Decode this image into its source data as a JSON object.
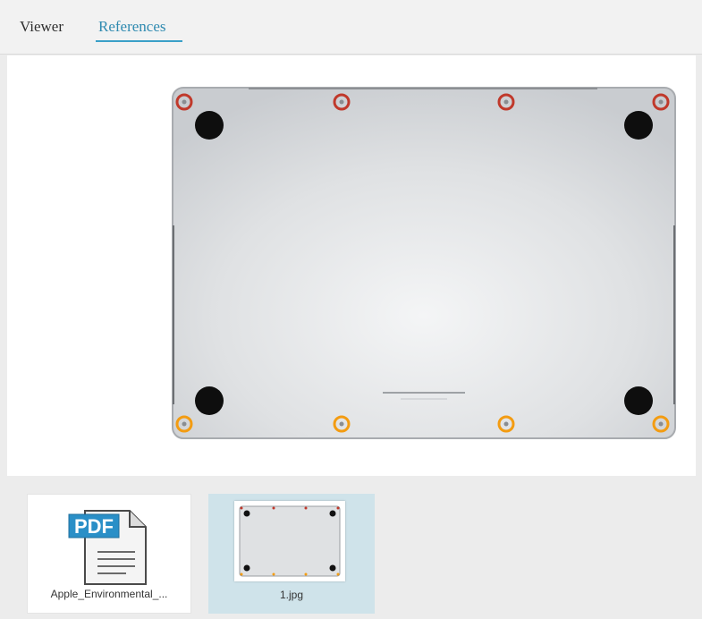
{
  "tabs": {
    "viewer": "Viewer",
    "references": "References",
    "active": "References"
  },
  "pdf_icon_text": "PDF",
  "thumbnails": [
    {
      "label": "Apple_Environmental_...",
      "type": "pdf",
      "selected": false
    },
    {
      "label": "1.jpg",
      "type": "image",
      "selected": true
    }
  ],
  "colors": {
    "accent": "#2f8ab0",
    "selected_thumb": "#cfe3ea",
    "screw_marker_top": "#c0392b",
    "screw_marker_bottom": "#f39c12"
  }
}
